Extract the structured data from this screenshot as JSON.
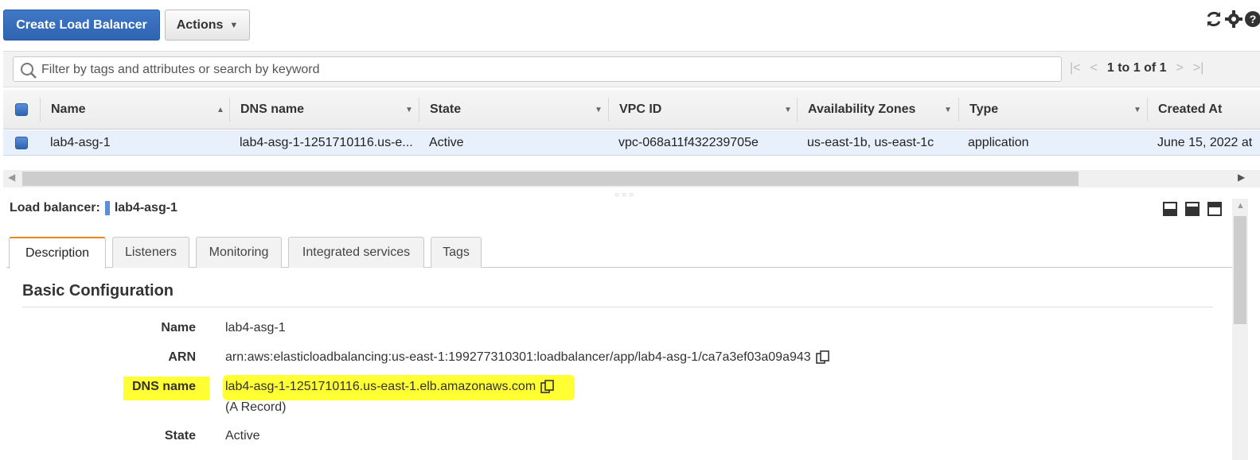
{
  "toolbar": {
    "create_label": "Create Load Balancer",
    "actions_label": "Actions"
  },
  "filter": {
    "placeholder": "Filter by tags and attributes or search by keyword",
    "pagination": "1 to 1 of 1"
  },
  "table": {
    "columns": [
      "Name",
      "DNS name",
      "State",
      "VPC ID",
      "Availability Zones",
      "Type",
      "Created At"
    ],
    "rows": [
      {
        "name": "lab4-asg-1",
        "dns_name": "lab4-asg-1-1251710116.us-e...",
        "state": "Active",
        "vpc_id": "vpc-068a11f432239705e",
        "zones": "us-east-1b, us-east-1c",
        "type": "application",
        "created_at": "June 15, 2022 at"
      }
    ]
  },
  "detail": {
    "header_label": "Load balancer:",
    "header_value": "lab4-asg-1",
    "tabs": [
      "Description",
      "Listeners",
      "Monitoring",
      "Integrated services",
      "Tags"
    ],
    "active_tab": "Description",
    "section_title": "Basic Configuration",
    "fields": {
      "name_label": "Name",
      "name_value": "lab4-asg-1",
      "arn_label": "ARN",
      "arn_value": "arn:aws:elasticloadbalancing:us-east-1:199277310301:loadbalancer/app/lab4-asg-1/ca7a3ef03a09a943",
      "dns_label": "DNS name",
      "dns_value": "lab4-asg-1-1251710116.us-east-1.elb.amazonaws.com",
      "dns_note": "(A Record)",
      "state_label": "State",
      "state_value": "Active"
    }
  },
  "colors": {
    "primary_button": "#2f63b0",
    "highlight": "#ffff33",
    "active_tab_accent": "#e58a1f",
    "selected_row": "#e8f0fb"
  },
  "icons": [
    "refresh-icon",
    "gear-icon",
    "help-icon",
    "search-icon",
    "copy-icon",
    "chevron-down-icon"
  ]
}
